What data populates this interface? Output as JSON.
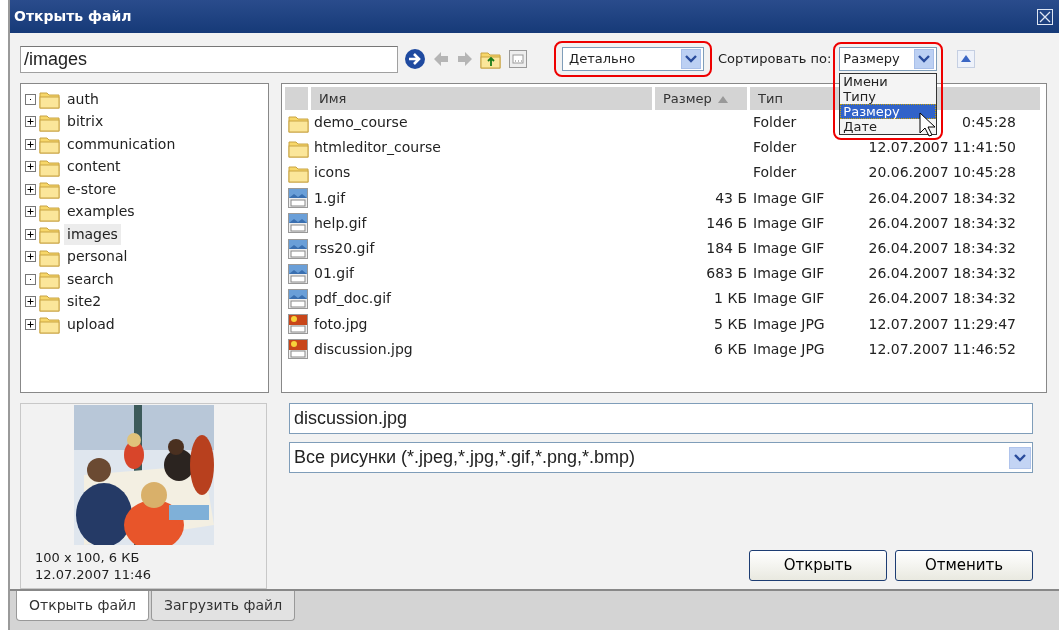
{
  "window": {
    "title": "Открыть файл"
  },
  "path": {
    "value": "/images"
  },
  "view_select": {
    "value": "Детально",
    "annotated": true
  },
  "sort": {
    "label": "Сортировать по:",
    "value": "Размеру",
    "annotated": true,
    "expanded": true,
    "options": [
      {
        "label": "Имени",
        "selected": false
      },
      {
        "label": "Типу",
        "selected": false
      },
      {
        "label": "Размеру",
        "selected": true
      },
      {
        "label": "Дате",
        "selected": false
      }
    ]
  },
  "tree": [
    {
      "label": "auth",
      "expandable": false,
      "selected": false
    },
    {
      "label": "bitrix",
      "expandable": true,
      "selected": false
    },
    {
      "label": "communication",
      "expandable": true,
      "selected": false
    },
    {
      "label": "content",
      "expandable": true,
      "selected": false
    },
    {
      "label": "e-store",
      "expandable": true,
      "selected": false
    },
    {
      "label": "examples",
      "expandable": true,
      "selected": false
    },
    {
      "label": "images",
      "expandable": true,
      "selected": true
    },
    {
      "label": "personal",
      "expandable": true,
      "selected": false
    },
    {
      "label": "search",
      "expandable": false,
      "selected": false
    },
    {
      "label": "site2",
      "expandable": true,
      "selected": false
    },
    {
      "label": "upload",
      "expandable": true,
      "selected": false
    }
  ],
  "file_list": {
    "columns": [
      {
        "label": "Имя",
        "sorted": false
      },
      {
        "label": "Размер",
        "sorted": true
      },
      {
        "label": "Тип",
        "sorted": false
      }
    ],
    "rows": [
      {
        "kind": "folder",
        "name": "demo_course",
        "type": "Folder",
        "modified": "0:45:28"
      },
      {
        "kind": "folder",
        "name": "htmleditor_course",
        "type": "Folder",
        "modified": "12.07.2007 11:41:50"
      },
      {
        "kind": "folder",
        "name": "icons",
        "type": "Folder",
        "modified": "20.06.2007 10:45:28"
      },
      {
        "kind": "gif",
        "name": "1.gif",
        "size": "43 Б",
        "type": "Image GIF",
        "modified": "26.04.2007 18:34:32"
      },
      {
        "kind": "gif",
        "name": "help.gif",
        "size": "146 Б",
        "type": "Image GIF",
        "modified": "26.04.2007 18:34:32"
      },
      {
        "kind": "gif",
        "name": "rss20.gif",
        "size": "184 Б",
        "type": "Image GIF",
        "modified": "26.04.2007 18:34:32"
      },
      {
        "kind": "gif",
        "name": "01.gif",
        "size": "683 Б",
        "type": "Image GIF",
        "modified": "26.04.2007 18:34:32"
      },
      {
        "kind": "gif",
        "name": "pdf_doc.gif",
        "size": "1 КБ",
        "type": "Image GIF",
        "modified": "26.04.2007 18:34:32"
      },
      {
        "kind": "jpg",
        "name": "foto.jpg",
        "size": "5 КБ",
        "type": "Image JPG",
        "modified": "12.07.2007 11:29:47"
      },
      {
        "kind": "jpg",
        "name": "discussion.jpg",
        "size": "6 КБ",
        "type": "Image JPG",
        "modified": "12.07.2007 11:46:52"
      }
    ]
  },
  "preview": {
    "kind": "picture",
    "info": [
      "100 x 100, 6 КБ",
      "12.07.2007 11:46"
    ]
  },
  "file_name": {
    "value": "discussion.jpg"
  },
  "filter": {
    "value": "Все рисунки (*.jpeg,*.jpg,*.gif,*.png,*.bmp)"
  },
  "buttons": [
    "Открыть",
    "Отменить"
  ],
  "tabs": [
    {
      "label": "Открыть файл",
      "selected": true
    },
    {
      "label": "Загрузить файл",
      "selected": false
    }
  ]
}
